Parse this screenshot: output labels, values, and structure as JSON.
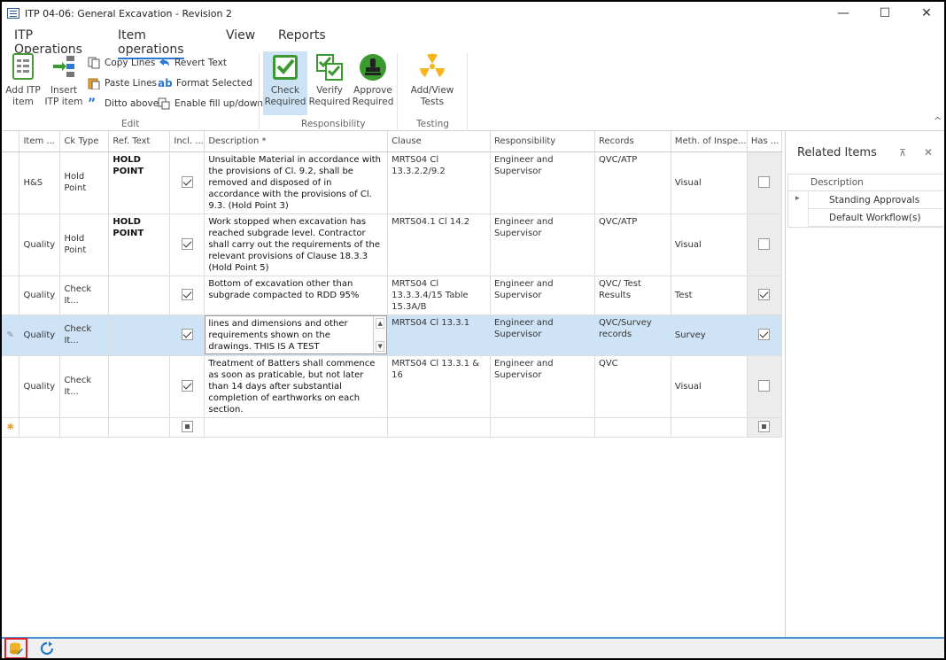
{
  "window": {
    "title": "ITP 04-06: General Excavation - Revision 2",
    "minimize": "—",
    "maximize": "☐",
    "close": "✕"
  },
  "tabs": [
    {
      "label": "ITP Operations",
      "active": false
    },
    {
      "label": "Item operations",
      "active": true
    },
    {
      "label": "View",
      "active": false
    },
    {
      "label": "Reports",
      "active": false
    }
  ],
  "ribbon": {
    "add_itp_item": "Add ITP\nitem",
    "insert_itp_item": "Insert\nITP item",
    "copy_lines": "Copy Lines",
    "paste_lines": "Paste Lines",
    "ditto_above": "Ditto above",
    "revert_text": "Revert Text",
    "format_selected": "Format Selected",
    "enable_fill": "Enable fill up/down",
    "edit_group": "Edit",
    "check_required": "Check\nRequired",
    "verify_required": "Verify\nRequired",
    "approve_required": "Approve\nRequired",
    "responsibility_group": "Responsibility",
    "add_view_tests": "Add/View\nTests",
    "testing_group": "Testing",
    "collapse_glyph": "^"
  },
  "grid": {
    "columns": [
      "Item ...",
      "Ck Type",
      "Ref. Text",
      "Incl. ...",
      "Description *",
      "Clause",
      "Responsibility",
      "Records",
      "Meth. of Inspe...",
      "Has ..."
    ],
    "rows": [
      {
        "item": "H&S",
        "ck_type": "Hold Point",
        "ref": "HOLD POINT",
        "incl": true,
        "description": "Unsuitable Material in accordance with the provisions of Cl. 9.2, shall be removed and disposed of in accordance with the provisions of Cl. 9.3. (Hold Point 3)",
        "clause": "MRTS04 Cl 13.3.2.2/9.2",
        "responsibility": "Engineer and Supervisor",
        "records": "QVC/ATP",
        "method": "Visual",
        "has": false
      },
      {
        "item": "Quality",
        "ck_type": "Hold Point",
        "ref": "HOLD POINT",
        "incl": true,
        "description": "Work stopped when excavation has reached subgrade level. Contractor shall carry out the requirements of the relevant provisions of Clause 18.3.3 (Hold Point 5)",
        "clause": "MRTS04.1 Cl 14.2",
        "responsibility": "Engineer and Supervisor",
        "records": "QVC/ATP",
        "method": "Visual",
        "has": false
      },
      {
        "item": "Quality",
        "ck_type": "Check It...",
        "ref": "",
        "incl": true,
        "description": "Bottom of excavation other than subgrade compacted to RDD 95%",
        "clause": "MRTS04 Cl 13.3.3.4/15 Table 15.3A/B",
        "responsibility": "Engineer and Supervisor",
        "records": "QVC/ Test Results",
        "method": "Test",
        "has": true
      },
      {
        "item": "Quality",
        "ck_type": "Check It...",
        "ref": "",
        "incl": true,
        "description": "lines and dimensions and other requirements shown on the drawings. THIS IS A TEST",
        "clause": "MRTS04 Cl 13.3.1",
        "responsibility": "Engineer and Supervisor",
        "records": "QVC/Survey records",
        "method": "Survey",
        "has": true
      },
      {
        "item": "Quality",
        "ck_type": "Check It...",
        "ref": "",
        "incl": true,
        "description": "Treatment of Batters shall commence as soon as praticable, but not later than 14 days after substantial completion of earthworks on each section.",
        "clause": "MRTS04 Cl 13.3.1 & 16",
        "responsibility": "Engineer and Supervisor",
        "records": "QVC",
        "method": "Visual",
        "has": false
      }
    ],
    "edit_glyph": "✎",
    "new_row_glyph": "✱"
  },
  "related": {
    "title": "Related Items",
    "pin": "⊼",
    "close": "✕",
    "column": "Description",
    "expand_glyph": "▸",
    "items": [
      "Standing Approvals",
      "Default Workflow(s)"
    ]
  },
  "colors": {
    "accent": "#2b79d0",
    "selected_row": "#cfe3f6",
    "green": "#3a9a2f",
    "testing_yellow": "#f6b51a"
  }
}
